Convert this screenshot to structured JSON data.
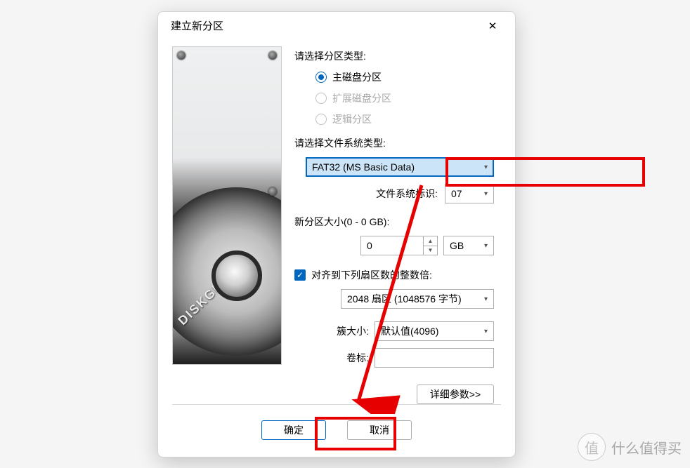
{
  "dialog": {
    "title": "建立新分区",
    "partition_type_label": "请选择分区类型:",
    "radios": {
      "primary": "主磁盘分区",
      "extended": "扩展磁盘分区",
      "logical": "逻辑分区"
    },
    "filesystem_label": "请选择文件系统类型:",
    "filesystem_value": "FAT32 (MS Basic Data)",
    "fsid_label": "文件系统标识:",
    "fsid_value": "07",
    "size_label": "新分区大小(0 - 0 GB):",
    "size_value": "0",
    "size_unit": "GB",
    "align_label": "对齐到下列扇区数的整数倍:",
    "align_value": "2048 扇区 (1048576 字节)",
    "cluster_label": "簇大小:",
    "cluster_value": "默认值(4096)",
    "volume_label": "卷标:",
    "volume_value": "",
    "details_btn": "详细参数>>",
    "ok": "确定",
    "cancel": "取消"
  },
  "brand": "DISKGENIUS",
  "watermark": "什么值得买"
}
